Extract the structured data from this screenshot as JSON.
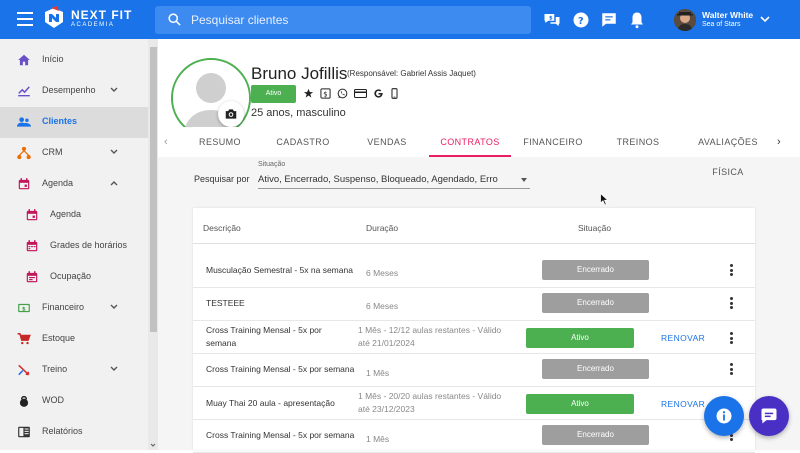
{
  "topbar": {
    "logo_text": "NEXT FIT",
    "logo_sub": "ACADEMIA",
    "search_placeholder": "Pesquisar clientes",
    "icons": [
      "menu-icon",
      "help-chat-icon",
      "help-icon",
      "messages-icon",
      "notifications-icon",
      "chevron-down-icon"
    ],
    "user": {
      "name": "Walter White",
      "org": "Sea of Stars"
    }
  },
  "sidebar": {
    "items": [
      {
        "label": "Início",
        "icon": "home-icon",
        "color": "#6a4fc9"
      },
      {
        "label": "Desempenho",
        "icon": "chart-icon",
        "color": "#6a4fc9",
        "chevron": "down"
      },
      {
        "label": "Clientes",
        "icon": "people-icon",
        "color": "#1a73e8",
        "active": true
      },
      {
        "label": "CRM",
        "icon": "crm-icon",
        "color": "#ef6c00",
        "chevron": "down"
      },
      {
        "label": "Agenda",
        "icon": "calendar-icon",
        "color": "#c2185b",
        "chevron": "up"
      },
      {
        "label": "Agenda",
        "icon": "calendar-icon",
        "color": "#c2185b",
        "sub": true
      },
      {
        "label": "Grades de horários",
        "icon": "calendar-grid-icon",
        "color": "#c2185b",
        "sub": true
      },
      {
        "label": "Ocupação",
        "icon": "calendar-occupancy-icon",
        "color": "#c2185b",
        "sub": true
      },
      {
        "label": "Financeiro",
        "icon": "money-icon",
        "color": "#43a047",
        "chevron": "down"
      },
      {
        "label": "Estoque",
        "icon": "cart-icon",
        "color": "#c62828"
      },
      {
        "label": "Treino",
        "icon": "training-icon",
        "color": "#d32f2f",
        "chevron": "down"
      },
      {
        "label": "WOD",
        "icon": "kettlebell-icon",
        "color": "#222222"
      },
      {
        "label": "Relatórios",
        "icon": "report-icon",
        "color": "#333333"
      }
    ]
  },
  "client": {
    "name": "Bruno Jofillis",
    "responsible": "(Responsável: Gabriel Assis Jaquet)",
    "status": "Ativo",
    "age_gender": "25 anos, masculino",
    "icons": [
      "star-icon",
      "dollar-icon",
      "whatsapp-icon",
      "card-icon",
      "google-icon",
      "phone-icon"
    ]
  },
  "tabs": [
    {
      "label": "RESUMO"
    },
    {
      "label": "CADASTRO"
    },
    {
      "label": "VENDAS"
    },
    {
      "label": "CONTRATOS",
      "active": true
    },
    {
      "label": "FINANCEIRO"
    },
    {
      "label": "TREINOS"
    },
    {
      "label": "AVALIAÇÕES FÍSICA"
    }
  ],
  "filter": {
    "label": "Pesquisar por",
    "field_label": "Situação",
    "value": "Ativo, Encerrado, Suspenso, Bloqueado, Agendado, Erro"
  },
  "table": {
    "headers": {
      "desc": "Descrição",
      "dur": "Duração",
      "status": "Situação"
    },
    "rows": [
      {
        "desc": [
          "Musculação Semestral - 5x na semana"
        ],
        "dur": [
          "6 Meses"
        ],
        "status": "Encerrado",
        "kind": "ended",
        "action": ""
      },
      {
        "desc": [
          "TESTEEE"
        ],
        "dur": [
          "6 Meses"
        ],
        "status": "Encerrado",
        "kind": "ended",
        "action": ""
      },
      {
        "desc": [
          "Cross Training Mensal - 5x por",
          "semana"
        ],
        "dur": [
          "1 Mês - 12/12 aulas restantes - Válido",
          "até 21/01/2024"
        ],
        "status": "Ativo",
        "kind": "active",
        "action": "RENOVAR"
      },
      {
        "desc": [
          "Cross Training Mensal - 5x por semana"
        ],
        "dur": [
          "1 Mês"
        ],
        "status": "Encerrado",
        "kind": "ended",
        "action": ""
      },
      {
        "desc": [
          "Muay Thai 20 aula - apresentação"
        ],
        "dur": [
          "1 Mês - 20/20 aulas restantes - Válido",
          "até 23/12/2023"
        ],
        "status": "Ativo",
        "kind": "active",
        "action": "RENOVAR"
      },
      {
        "desc": [
          "Cross Training Mensal - 5x por semana"
        ],
        "dur": [
          "1 Mês"
        ],
        "status": "Encerrado",
        "kind": "ended",
        "action": ""
      }
    ]
  },
  "colors": {
    "topbar": "#1a73e8",
    "active_tab": "#e91e63",
    "status_active": "#4caf50",
    "status_ended": "#9e9e9e"
  }
}
